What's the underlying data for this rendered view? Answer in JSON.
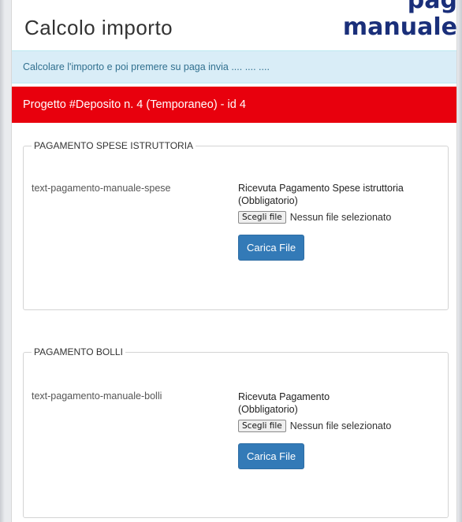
{
  "overlay": {
    "partial_word": "pag",
    "word": "manuale"
  },
  "header": {
    "title": "Calcolo importo"
  },
  "info_message": "Calcolare l'importo e poi premere su paga invia .... .... ....",
  "project_bar": "Progetto #Deposito n. 4 (Temporaneo) - id 4",
  "sections": [
    {
      "legend": "PAGAMENTO SPESE ISTRUTTORIA",
      "description": "text-pagamento-manuale-spese",
      "upload_label": "Ricevuta Pagamento Spese istruttoria (Obbligatorio)",
      "choose_label": "Scegli file",
      "no_file_text": "Nessun file selezionato",
      "upload_button": "Carica File"
    },
    {
      "legend": "PAGAMENTO BOLLI",
      "description": "text-pagamento-manuale-bolli",
      "upload_label": "Ricevuta Pagamento (Obbligatorio)",
      "choose_label": "Scegli file",
      "no_file_text": "Nessun file selezionato",
      "upload_button": "Carica File"
    }
  ],
  "colors": {
    "info_bg": "#d9edf7",
    "project_bar_bg": "#e8000d",
    "button_primary": "#337ab7",
    "overlay_text": "#1a2f7a"
  }
}
